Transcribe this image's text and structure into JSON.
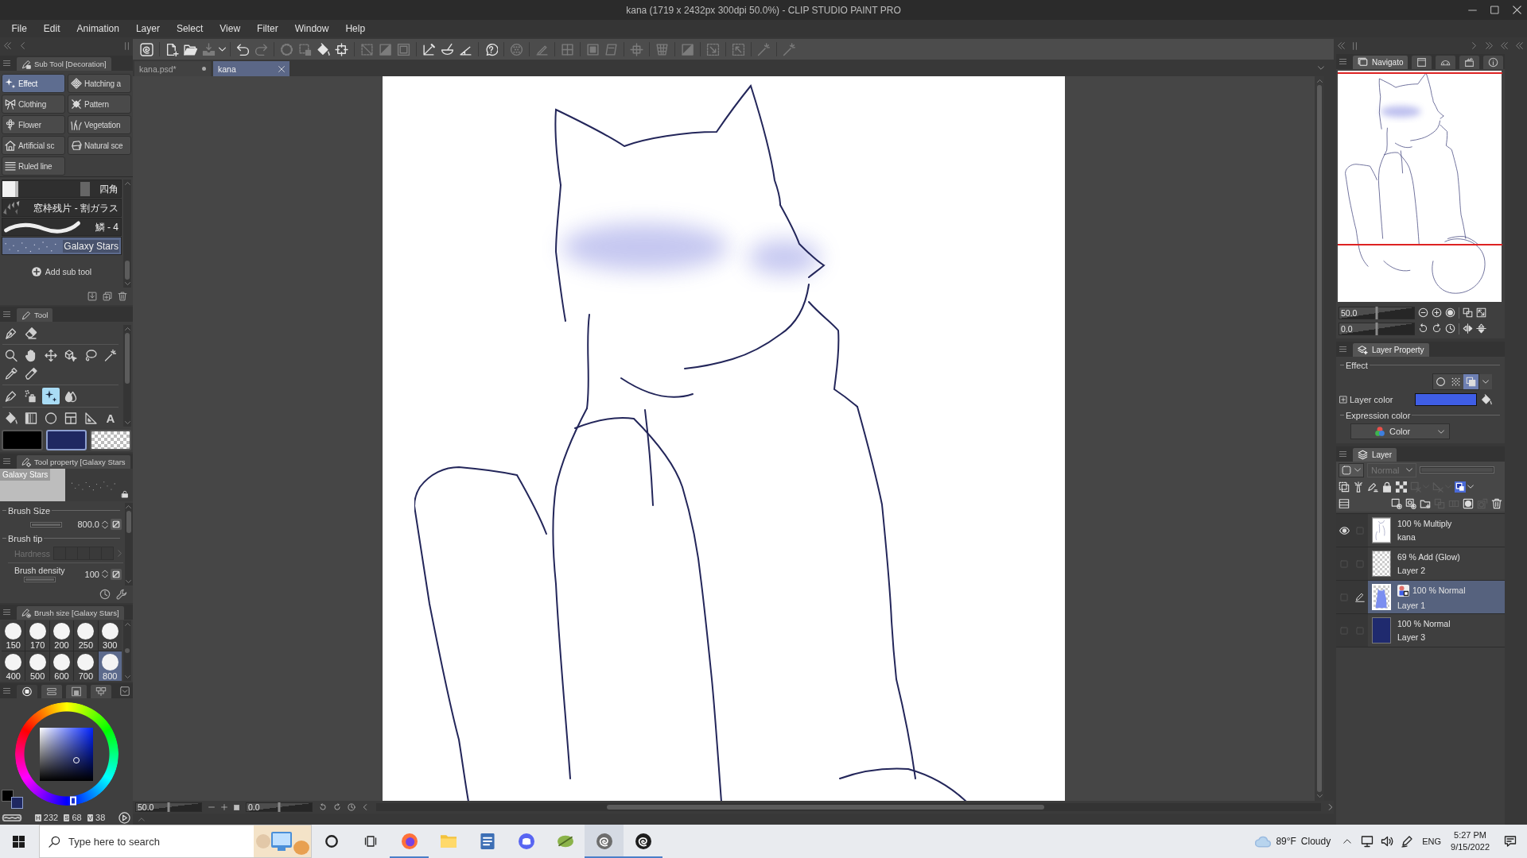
{
  "window": {
    "title": "kana (1719 x 2432px 300dpi 50.0%) - CLIP STUDIO PAINT PRO"
  },
  "menu": [
    "File",
    "Edit",
    "Animation",
    "Layer",
    "Select",
    "View",
    "Filter",
    "Window",
    "Help"
  ],
  "toolbar": [
    [
      {
        "kind": "logo",
        "disabled": false
      }
    ],
    [
      {
        "kind": "new",
        "disabled": false
      },
      {
        "kind": "open",
        "disabled": false
      },
      {
        "kind": "export",
        "disabled": true
      },
      {
        "kind": "caret",
        "disabled": false
      }
    ],
    [
      {
        "kind": "undo",
        "disabled": false
      },
      {
        "kind": "redo",
        "disabled": true
      }
    ],
    [
      {
        "kind": "spinner",
        "disabled": true
      },
      {
        "kind": "marquee",
        "disabled": true
      },
      {
        "kind": "bucket",
        "disabled": false
      },
      {
        "kind": "crop",
        "disabled": false
      }
    ],
    [
      {
        "kind": "diagonal",
        "disabled": true
      },
      {
        "kind": "halftone",
        "disabled": true
      },
      {
        "kind": "frame",
        "disabled": true
      }
    ],
    [
      {
        "kind": "line",
        "disabled": false
      },
      {
        "kind": "bowl",
        "disabled": false
      },
      {
        "kind": "angle",
        "disabled": false
      }
    ],
    [
      {
        "kind": "help",
        "disabled": false
      }
    ],
    [
      {
        "kind": "checker",
        "disabled": true
      }
    ],
    [
      {
        "kind": "pencil",
        "disabled": true
      }
    ],
    [
      {
        "kind": "grid",
        "disabled": true
      }
    ],
    [
      {
        "kind": "layer",
        "disabled": true
      },
      {
        "kind": "sheet",
        "disabled": true
      }
    ],
    [
      {
        "kind": "transform",
        "disabled": true
      }
    ],
    [
      {
        "kind": "mesh",
        "disabled": true
      }
    ],
    [
      {
        "kind": "halftone",
        "disabled": true
      }
    ],
    [
      {
        "kind": "expand",
        "disabled": true
      }
    ],
    [
      {
        "kind": "shrink",
        "disabled": true
      }
    ],
    [
      {
        "kind": "wand",
        "disabled": true
      }
    ],
    [
      {
        "kind": "wand",
        "disabled": true
      }
    ]
  ],
  "document_tabs": [
    {
      "label": "kana.psd*",
      "selected": false
    },
    {
      "label": "kana",
      "selected": true
    }
  ],
  "sub_tool": {
    "title": "Sub Tool [Decoration]",
    "groups": [
      {
        "kind": "sparkle",
        "label": "Effect",
        "selected": true
      },
      {
        "kind": "hatch",
        "label": "Hatching a",
        "selected": false
      },
      {
        "kind": "bow",
        "label": "Clothing",
        "selected": false
      },
      {
        "kind": "pattern",
        "label": "Pattern",
        "selected": false
      },
      {
        "kind": "flower",
        "label": "Flower",
        "selected": false
      },
      {
        "kind": "grass",
        "label": "Vegetation",
        "selected": false
      },
      {
        "kind": "house",
        "label": "Artificial sc",
        "selected": false
      },
      {
        "kind": "rock",
        "label": "Natural sce",
        "selected": false
      },
      {
        "kind": "lines",
        "label": "Ruled line",
        "selected": false
      }
    ],
    "items": [
      {
        "kind": "bars",
        "label": "四角",
        "selected": false
      },
      {
        "kind": "shards",
        "label": "窓枠残片 - 割ガラス",
        "selected": false
      },
      {
        "kind": "stroke",
        "label": "鱗 - 4",
        "selected": false
      },
      {
        "kind": "stars",
        "label": "Galaxy Stars",
        "selected": true
      }
    ],
    "add_label": "Add sub tool"
  },
  "tool_panel": {
    "title": "Tool",
    "groups": [
      [
        [
          {
            "kind": "pen",
            "selected": false
          },
          {
            "kind": "eraser",
            "selected": false
          }
        ]
      ],
      [
        [
          {
            "kind": "zoom",
            "selected": false
          },
          {
            "kind": "hand",
            "selected": false
          },
          {
            "kind": "move",
            "selected": false
          },
          {
            "kind": "object",
            "selected": false
          },
          {
            "kind": "lasso",
            "selected": false
          },
          {
            "kind": "wand",
            "selected": false
          }
        ],
        [
          {
            "kind": "eyedropper",
            "selected": false
          },
          {
            "kind": "marker",
            "selected": false
          }
        ]
      ],
      [
        [
          {
            "kind": "nib",
            "selected": false
          },
          {
            "kind": "airbrush",
            "selected": false
          },
          {
            "kind": "sparkle",
            "selected": true
          },
          {
            "kind": "blend",
            "selected": false
          }
        ]
      ],
      [
        [
          {
            "kind": "bucket",
            "selected": false
          },
          {
            "kind": "gradient",
            "selected": false
          },
          {
            "kind": "circle",
            "selected": false
          },
          {
            "kind": "panel",
            "selected": false
          },
          {
            "kind": "ruler",
            "selected": false
          },
          {
            "kind": "text",
            "glyph": "A",
            "selected": false
          }
        ]
      ]
    ]
  },
  "colors": [
    {
      "kind": "solid",
      "color": "#000000",
      "selected": false
    },
    {
      "kind": "solid",
      "color": "#1f2861",
      "selected": true
    },
    {
      "kind": "transparent",
      "selected": false
    }
  ],
  "tool_property": {
    "title": "Tool property [Galaxy Stars",
    "preview_label": "Galaxy Stars",
    "settings": [
      {
        "kind": "section",
        "label": "Brush Size"
      },
      {
        "kind": "slider",
        "value": "800.0",
        "level": 1
      },
      {
        "kind": "section",
        "label": "Brush tip"
      },
      {
        "kind": "cells",
        "label": "Hardness",
        "disabled": true
      },
      {
        "kind": "slider",
        "label": "Brush density",
        "value": "100",
        "level": 1
      }
    ]
  },
  "brush_size": {
    "title": "Brush size [Galaxy Stars]",
    "sizes": [
      {
        "label": "150",
        "selected": false
      },
      {
        "label": "170",
        "selected": false
      },
      {
        "label": "200",
        "selected": false
      },
      {
        "label": "250",
        "selected": false
      },
      {
        "label": "300",
        "selected": false
      },
      {
        "label": "400",
        "selected": false
      },
      {
        "label": "500",
        "selected": false
      },
      {
        "label": "600",
        "selected": false
      },
      {
        "label": "700",
        "selected": false
      },
      {
        "label": "800",
        "selected": true
      }
    ]
  },
  "color_panel": {
    "tabs": [
      {
        "kind": "ring",
        "selected": true
      },
      {
        "kind": "sliders",
        "selected": false
      },
      {
        "kind": "set",
        "selected": false
      },
      {
        "kind": "mixer",
        "selected": false
      }
    ],
    "chips": [
      {
        "color": "#000000",
        "selected": false
      },
      {
        "color": "#1f2861",
        "selected": true
      }
    ],
    "values": [
      {
        "label": "H",
        "value": "232"
      },
      {
        "label": "S",
        "value": "68"
      },
      {
        "label": "V",
        "value": "38"
      }
    ]
  },
  "status_bar": {
    "zoom": {
      "value": "50.0",
      "level": 0.5
    },
    "rotation": {
      "value": "0.0",
      "level": 0.5
    }
  },
  "navigator": {
    "tabs": [
      {
        "kind": "navigator",
        "label": "Navigato",
        "selected": true
      },
      {
        "kind": "subview",
        "selected": false
      },
      {
        "kind": "dome",
        "selected": false
      },
      {
        "kind": "clapper",
        "selected": false
      },
      {
        "kind": "info",
        "selected": false
      }
    ],
    "zoom": {
      "value": "50.0",
      "level": 0.5
    },
    "rotation": {
      "value": "0.0",
      "level": 0.5
    }
  },
  "layer_property": {
    "title": "Layer Property",
    "effect_label": "Effect",
    "effects": [
      {
        "kind": "outline",
        "selected": false
      },
      {
        "kind": "tone",
        "selected": false
      },
      {
        "kind": "overlap",
        "selected": true
      }
    ],
    "layer_color": {
      "label": "Layer color",
      "color": "#3f5ee6"
    },
    "expression": {
      "label": "Expression color",
      "value": "Color"
    }
  },
  "layer_panel": {
    "title": "Layer",
    "blend_mode": {
      "value": "Normal",
      "disabled": true
    },
    "opacity": {
      "level": 1
    },
    "tools": [
      [
        {
          "kind": "clip",
          "disabled": false
        },
        {
          "kind": "reference",
          "disabled": false
        },
        {
          "kind": "penlock",
          "disabled": false
        },
        {
          "kind": "lock",
          "disabled": false
        },
        {
          "kind": "alphalock",
          "disabled": false
        },
        {
          "kind": "maskx",
          "disabled": true
        },
        {
          "kind": "caret",
          "disabled": true
        },
        {
          "kind": "rulerx",
          "disabled": true
        },
        {
          "kind": "caret",
          "disabled": true
        },
        {
          "kind": "layercolor",
          "disabled": false
        },
        {
          "kind": "caret",
          "disabled": false
        }
      ],
      [
        {
          "kind": "list",
          "disabled": false
        },
        {
          "kind": "raster",
          "disabled": false
        },
        {
          "kind": "vector",
          "disabled": false
        },
        {
          "kind": "newfolder",
          "disabled": false
        },
        {
          "kind": "transfer",
          "disabled": true
        },
        {
          "kind": "merge",
          "disabled": true
        },
        {
          "kind": "mask",
          "disabled": false
        },
        {
          "kind": "applymask",
          "disabled": true
        },
        {
          "kind": "trash",
          "disabled": false
        }
      ]
    ],
    "layers": [
      {
        "kind": "sketch",
        "mode": "100 % Multiply",
        "name": "kana",
        "visible": true,
        "editing": false,
        "selected": false,
        "layer_color": false
      },
      {
        "kind": "transparent",
        "mode": "69 % Add (Glow)",
        "name": "Layer 2",
        "visible": false,
        "editing": false,
        "selected": false,
        "layer_color": false
      },
      {
        "kind": "figure",
        "mode": "100 % Normal",
        "name": "Layer 1",
        "visible": false,
        "editing": true,
        "selected": true,
        "layer_color": true
      },
      {
        "kind": "solid",
        "mode": "100 % Normal",
        "name": "Layer 3",
        "visible": false,
        "editing": false,
        "selected": false,
        "layer_color": false
      }
    ]
  },
  "taskbar": {
    "search": {
      "placeholder": "Type here to search"
    },
    "apps": [
      {
        "kind": "firefox",
        "running": true,
        "selected": false
      },
      {
        "kind": "explorer",
        "running": false,
        "selected": false
      },
      {
        "kind": "mail",
        "running": false,
        "selected": false
      },
      {
        "kind": "discord",
        "running": false,
        "selected": false
      },
      {
        "kind": "plant",
        "running": false,
        "selected": false
      },
      {
        "kind": "clip",
        "running": true,
        "selected": true
      },
      {
        "kind": "clipstudio",
        "running": true,
        "selected": false
      }
    ],
    "weather": {
      "temperature": "89°F",
      "condition": "Cloudy"
    },
    "language": "ENG",
    "time": "5:27 PM",
    "date": "9/15/2022"
  }
}
